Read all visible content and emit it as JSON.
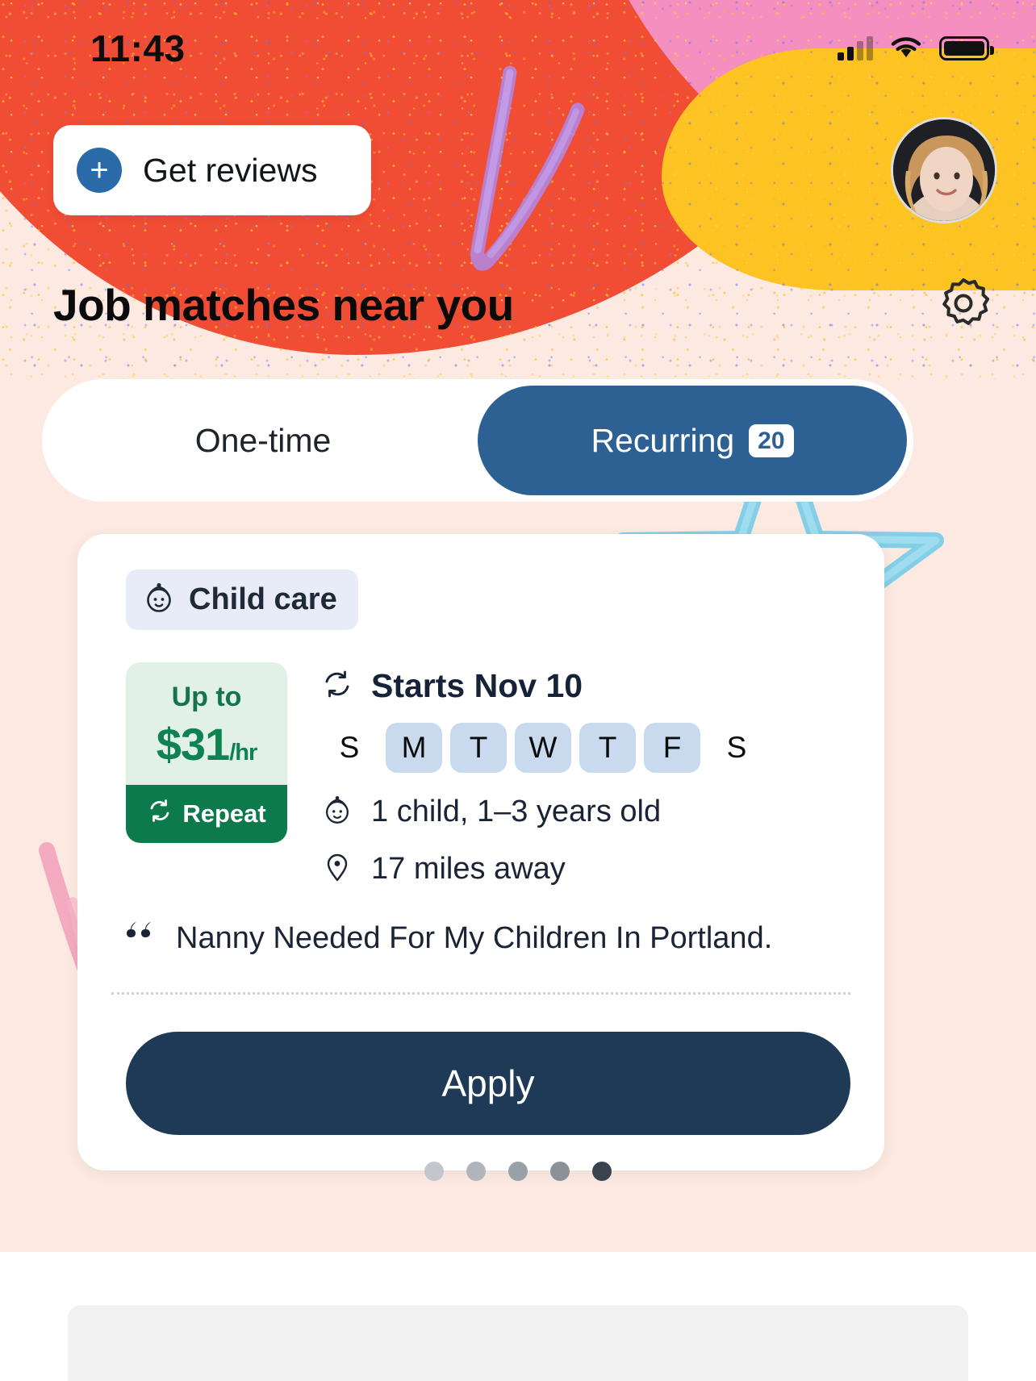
{
  "status_bar": {
    "time": "11:43",
    "signal_icon": "cellular-signal-icon",
    "wifi_icon": "wifi-icon",
    "battery_icon": "battery-icon"
  },
  "header": {
    "get_reviews_label": "Get reviews",
    "plus_icon": "plus-icon",
    "avatar_icon": "user-avatar",
    "title": "Job matches near you",
    "settings_icon": "gear-icon"
  },
  "toggle": {
    "one_time_label": "One-time",
    "recurring_label": "Recurring",
    "recurring_count": "20",
    "active": "Recurring"
  },
  "card": {
    "category_label": "Child care",
    "category_icon": "child-face-icon",
    "pay": {
      "prefix": "Up to",
      "amount": "$31",
      "unit": "/hr",
      "repeat_label": "Repeat",
      "repeat_icon": "refresh-icon"
    },
    "starts_label": "Starts Nov 10",
    "starts_icon": "recurring-icon",
    "days": [
      {
        "letter": "S",
        "selected": false
      },
      {
        "letter": "M",
        "selected": true
      },
      {
        "letter": "T",
        "selected": true
      },
      {
        "letter": "W",
        "selected": true
      },
      {
        "letter": "T",
        "selected": true
      },
      {
        "letter": "F",
        "selected": true
      },
      {
        "letter": "S",
        "selected": false
      }
    ],
    "children_text": "1 child, 1–3 years old",
    "children_icon": "child-face-icon",
    "distance_text": "17 miles away",
    "distance_icon": "location-pin-icon",
    "quote_text": "Nanny Needed For My Children In Portland.",
    "quote_icon": "quote-icon",
    "apply_label": "Apply"
  },
  "pagination": {
    "total": 5,
    "active_index": 5
  },
  "colors": {
    "accent_blue": "#2d6193",
    "pay_green": "#0f8251",
    "apply_navy": "#1e3a56",
    "page_bg": "#fbe9e2",
    "chip_blue": "#cadaee"
  }
}
